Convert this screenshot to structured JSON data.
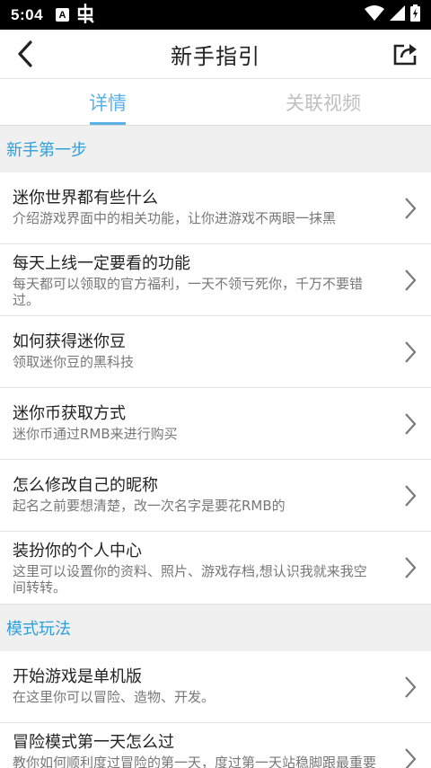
{
  "status_bar": {
    "time": "5:04",
    "notif_a_label": "A",
    "icons": [
      "a-notification-icon",
      "bug-icon",
      "wifi-icon",
      "signal-icon",
      "battery-icon"
    ]
  },
  "toolbar": {
    "title": "新手指引",
    "back_icon": "back-arrow-icon",
    "share_icon": "share-icon"
  },
  "tabs": [
    {
      "label": "详情",
      "active": true
    },
    {
      "label": "关联视频",
      "active": false
    }
  ],
  "colors": {
    "accent": "#2f9fd8",
    "tab_active": "#5ab1e6",
    "tab_inactive": "#bfbfbf"
  },
  "sections": [
    {
      "header": "新手第一步",
      "items": [
        {
          "title": "迷你世界都有些什么",
          "desc": "介绍游戏界面中的相关功能，让你进游戏不两眼一抹黑"
        },
        {
          "title": "每天上线一定要看的功能",
          "desc": "每天都可以领取的官方福利，一天不领亏死你，千万不要错过。"
        },
        {
          "title": "如何获得迷你豆",
          "desc": "领取迷你豆的黑科技"
        },
        {
          "title": "迷你币获取方式",
          "desc": "迷你币通过RMB来进行购买"
        },
        {
          "title": "怎么修改自己的昵称",
          "desc": "起名之前要想清楚，改一次名字是要花RMB的"
        },
        {
          "title": "装扮你的个人中心",
          "desc": "这里可以设置你的资料、照片、游戏存档,想认识我就来我空间转转。"
        }
      ]
    },
    {
      "header": "模式玩法",
      "items": [
        {
          "title": "开始游戏是单机版",
          "desc": "在这里你可以冒险、造物、开发。"
        },
        {
          "title": "冒险模式第一天怎么过",
          "desc": "教你如何顺利度过冒险的第一天，度过第一天站稳脚跟最重要"
        }
      ]
    }
  ]
}
